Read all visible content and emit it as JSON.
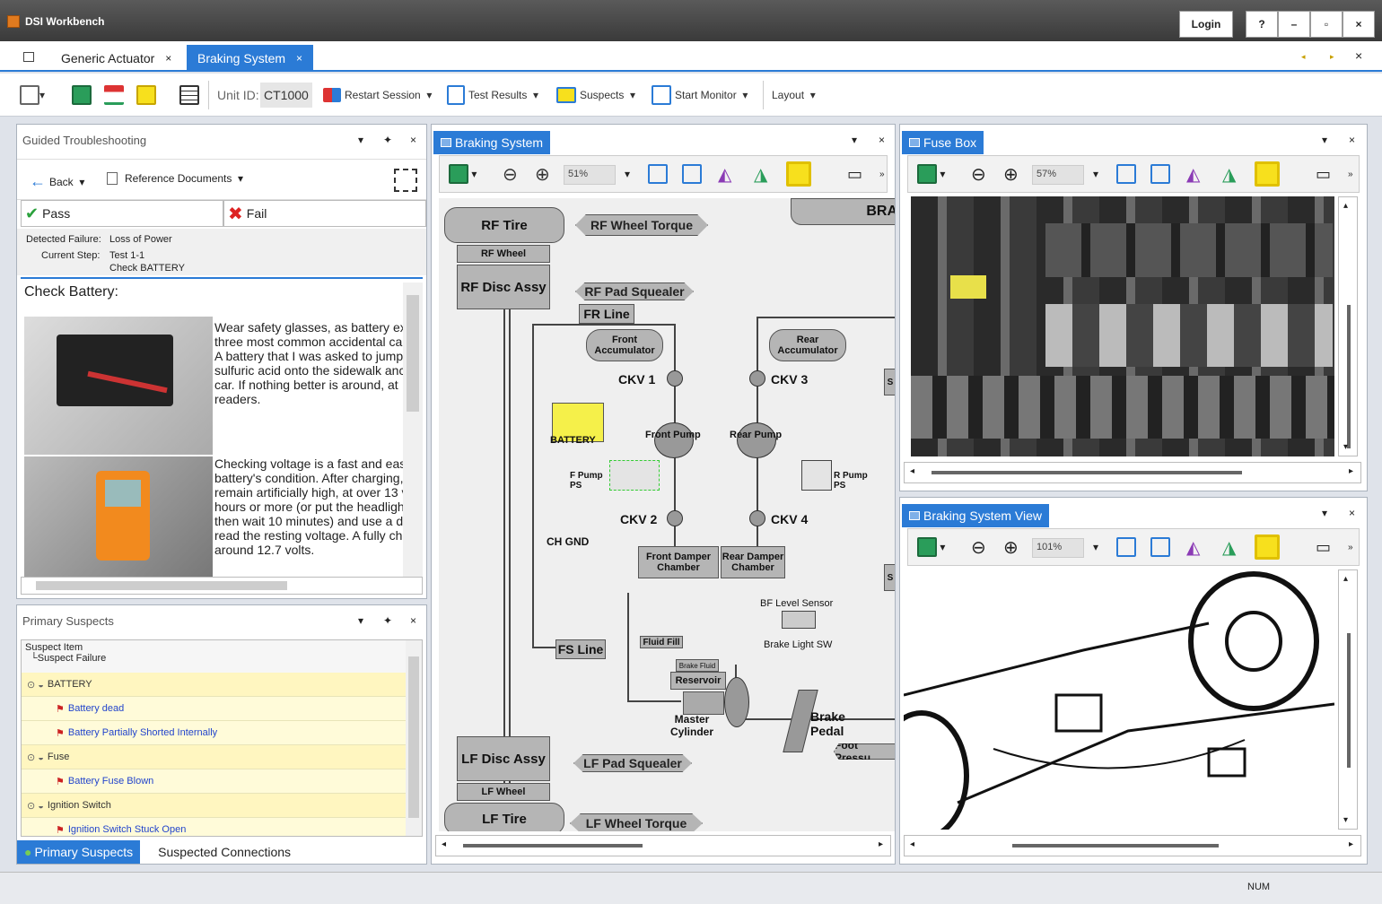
{
  "app": {
    "title": "DSI Workbench",
    "login": "Login",
    "help": "?",
    "minimize": "–",
    "maximize": "▫",
    "close": "×"
  },
  "tabs": [
    {
      "label": "Generic Actuator",
      "close": "×"
    },
    {
      "label": "Braking System",
      "close": "×"
    }
  ],
  "toolbar": {
    "unit_label": "Unit ID:",
    "unit_value": "CT1000",
    "restart": "Restart Session",
    "test_results": "Test Results",
    "suspects": "Suspects",
    "start_monitor": "Start Monitor",
    "layout": "Layout",
    "dd": "▾"
  },
  "guided": {
    "title": "Guided Troubleshooting",
    "back": "Back",
    "ref_docs": "Reference Documents",
    "pass": "Pass",
    "fail": "Fail",
    "detected_label": "Detected Failure:",
    "detected_value": "Loss of Power",
    "step_label": "Current Step:",
    "step_value": "Test 1-1",
    "step_value2": "Check BATTERY",
    "heading": "Check Battery:",
    "para1": "Wear safety glasses, as battery ex three most common accidental ca A battery that I was asked to jump sulfuric acid onto the sidewalk anc car. If nothing better is around, at readers.",
    "para2": "Checking voltage is a fast and eas battery's condition. After charging, remain artificially high, at over 13 v hours or more (or put the headligh then wait 10 minutes) and use a d read the resting voltage. A fully ch around 12.7 volts."
  },
  "suspects": {
    "title": "Primary Suspects",
    "col1": "Suspect Item",
    "col2": "└Suspect Failure",
    "rows": [
      {
        "type": "grp",
        "label": "BATTERY"
      },
      {
        "type": "item",
        "label": "Battery dead"
      },
      {
        "type": "item",
        "label": "Battery Partially Shorted Internally"
      },
      {
        "type": "grp",
        "label": "Fuse"
      },
      {
        "type": "item",
        "label": "Battery Fuse Blown"
      },
      {
        "type": "grp",
        "label": "Ignition Switch"
      },
      {
        "type": "item",
        "label": "Ignition Switch Stuck Open"
      }
    ],
    "tab_primary": "Primary Suspects",
    "tab_connections": "Suspected Connections"
  },
  "braking": {
    "title": "Braking System",
    "zoom": "51%"
  },
  "diagram": {
    "rf_tire": "RF Tire",
    "rf_wheel": "RF Wheel",
    "rf_disc": "RF Disc Assy",
    "rf_torque": "RF Wheel Torque",
    "rf_pad": "RF Pad Squealer",
    "fr_line": "FR Line",
    "front_acc": "Front Accumulator",
    "rear_acc": "Rear Accumulator",
    "ckv1": "CKV 1",
    "ckv2": "CKV 2",
    "ckv3": "CKV 3",
    "ckv4": "CKV 4",
    "battery": "BATTERY",
    "front_pump": "Front Pump",
    "rear_pump": "Rear Pump",
    "f_pump_ps": "F Pump PS",
    "r_pump_ps": "R Pump PS",
    "ch_gnd": "CH GND",
    "front_damper": "Front Damper Chamber",
    "rear_damper": "Rear Damper Chamber",
    "bf_level": "BF Level Sensor",
    "brake_light": "Brake Light SW",
    "fs_line": "FS Line",
    "fluid_fill": "Fluid Fill",
    "brake_fluid": "Brake Fluid",
    "reservoir": "Reservoir",
    "master": "Master Cylinder",
    "brake_pedal": "Brake Pedal",
    "foot_pressure": "Foot Pressu",
    "lf_disc": "LF Disc Assy",
    "lf_pad": "LF Pad Squealer",
    "lf_wheel": "LF Wheel",
    "lf_tire": "LF Tire",
    "lf_torque": "LF Wheel Torque",
    "bra": "BRA",
    "s": "S"
  },
  "fusebox": {
    "title": "Fuse Box",
    "zoom": "57%"
  },
  "bsview": {
    "title": "Braking System View",
    "zoom": "101%"
  },
  "status": {
    "num": "NUM"
  }
}
